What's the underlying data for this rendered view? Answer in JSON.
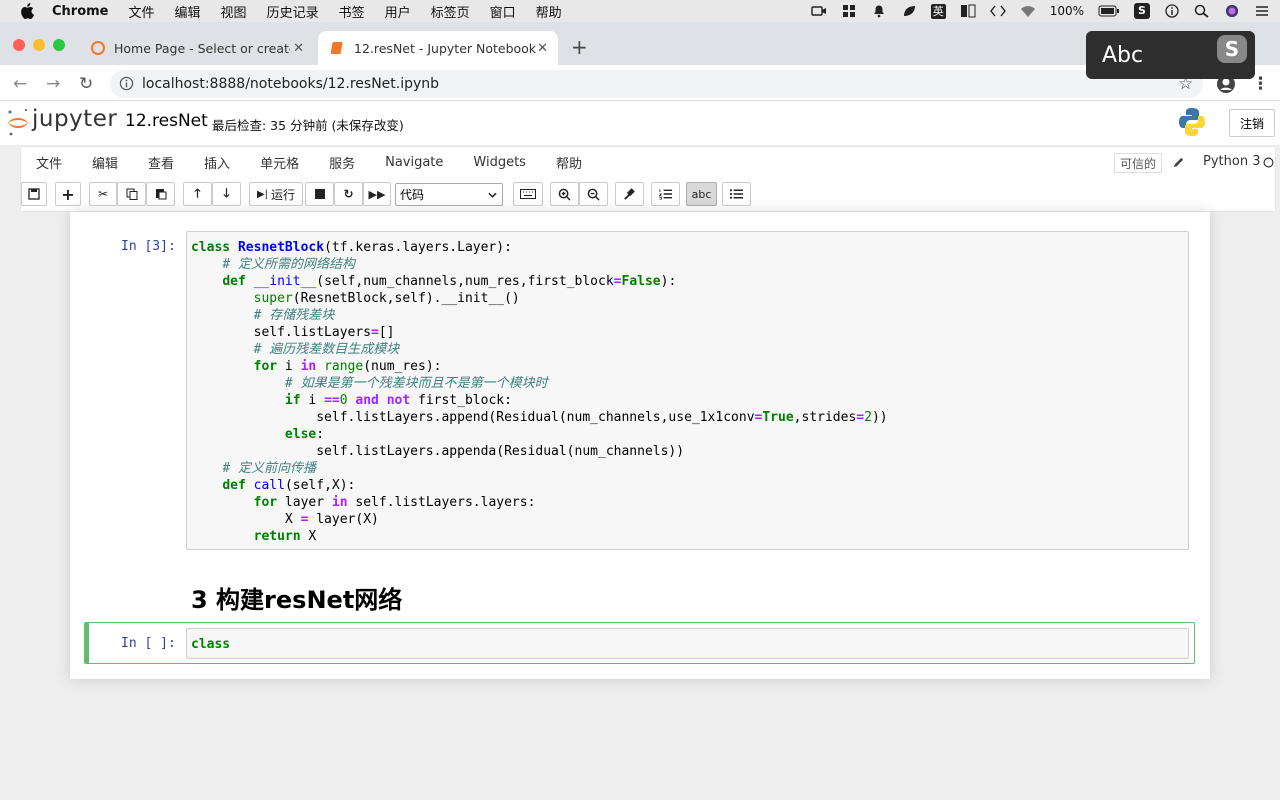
{
  "mac_menu": {
    "app": "Chrome",
    "items": [
      "文件",
      "编辑",
      "视图",
      "历史记录",
      "书签",
      "用户",
      "标签页",
      "窗口",
      "帮助"
    ],
    "battery": "100%"
  },
  "tabs": [
    {
      "title": "Home Page - Select or create a"
    },
    {
      "title": "12.resNet - Jupyter Notebook"
    }
  ],
  "url": "localhost:8888/notebooks/12.resNet.ipynb",
  "popup": {
    "text": "Abc"
  },
  "jupyter": {
    "logo_text": "jupyter",
    "notebook_name": "12.resNet",
    "checkpoint": "最后检查: 35 分钟前  (未保存改变)",
    "logout": "注销",
    "menu": [
      "文件",
      "编辑",
      "查看",
      "插入",
      "单元格",
      "服务",
      "Navigate",
      "Widgets",
      "帮助"
    ],
    "trusted": "可信的",
    "kernel": "Python 3",
    "run_label": "运行",
    "cell_type": "代码"
  },
  "cells": {
    "code_prompt": "In [3]:",
    "heading": "3  构建resNet网络",
    "empty_prompt": "In [ ]:",
    "empty_code": "class"
  },
  "colors": {
    "accent_green": "#66bb6a",
    "prompt_blue": "#303f9f",
    "jupyter_orange": "#f37726"
  }
}
